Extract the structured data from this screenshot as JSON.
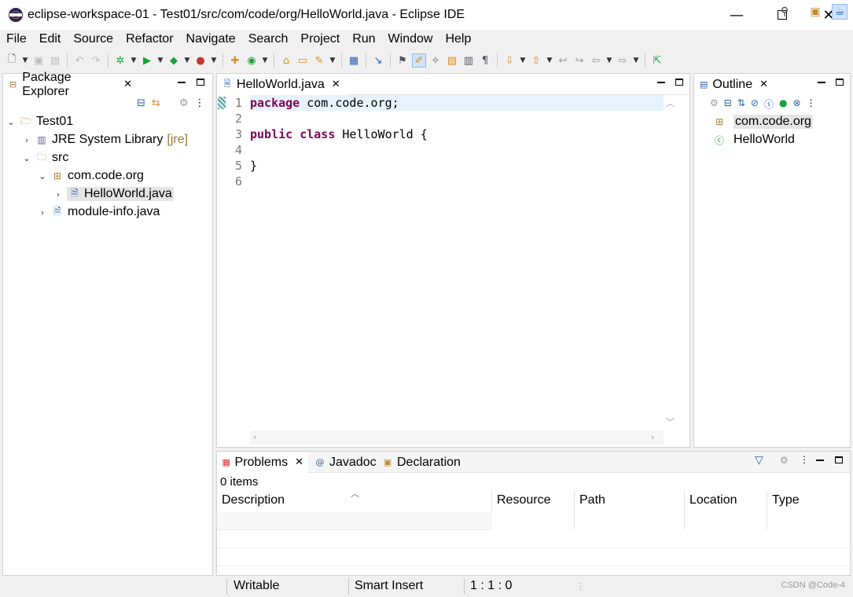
{
  "window": {
    "title": "eclipse-workspace-01 - Test01/src/com/code/org/HelloWorld.java - Eclipse IDE",
    "min": "—",
    "close": "✕"
  },
  "menu": [
    "File",
    "Edit",
    "Source",
    "Refactor",
    "Navigate",
    "Search",
    "Project",
    "Run",
    "Window",
    "Help"
  ],
  "package_explorer": {
    "tab_label": "Package Explorer",
    "tree": {
      "project": "Test01",
      "jre": "JRE System Library",
      "jre_decor": "[jre]",
      "src": "src",
      "package": "com.code.org",
      "file_selected": "HelloWorld.java",
      "module_info": "module-info.java"
    }
  },
  "editor": {
    "tab_label": "HelloWorld.java",
    "line_numbers": [
      "1",
      "2",
      "3",
      "4",
      "5",
      "6"
    ],
    "code": {
      "line1_kw": "package",
      "line1_rest": " com.code.org;",
      "line3_kw1": "public",
      "line3_kw2": "class",
      "line3_rest": " HelloWorld {",
      "line5": "}"
    }
  },
  "outline": {
    "tab_label": "Outline",
    "items": [
      "com.code.org",
      "HelloWorld"
    ]
  },
  "bottom": {
    "tabs": [
      "Problems",
      "Javadoc",
      "Declaration"
    ],
    "items_count": "0 items",
    "columns": [
      "Description",
      "Resource",
      "Path",
      "Location",
      "Type"
    ]
  },
  "status": {
    "writable": "Writable",
    "insert_mode": "Smart Insert",
    "position": "1 : 1 : 0",
    "watermark": "CSDN @Code-4"
  },
  "colors": {
    "keyword": "#7f0055",
    "current_line": "#e8f2fe",
    "selection": "#e5e5e5"
  }
}
